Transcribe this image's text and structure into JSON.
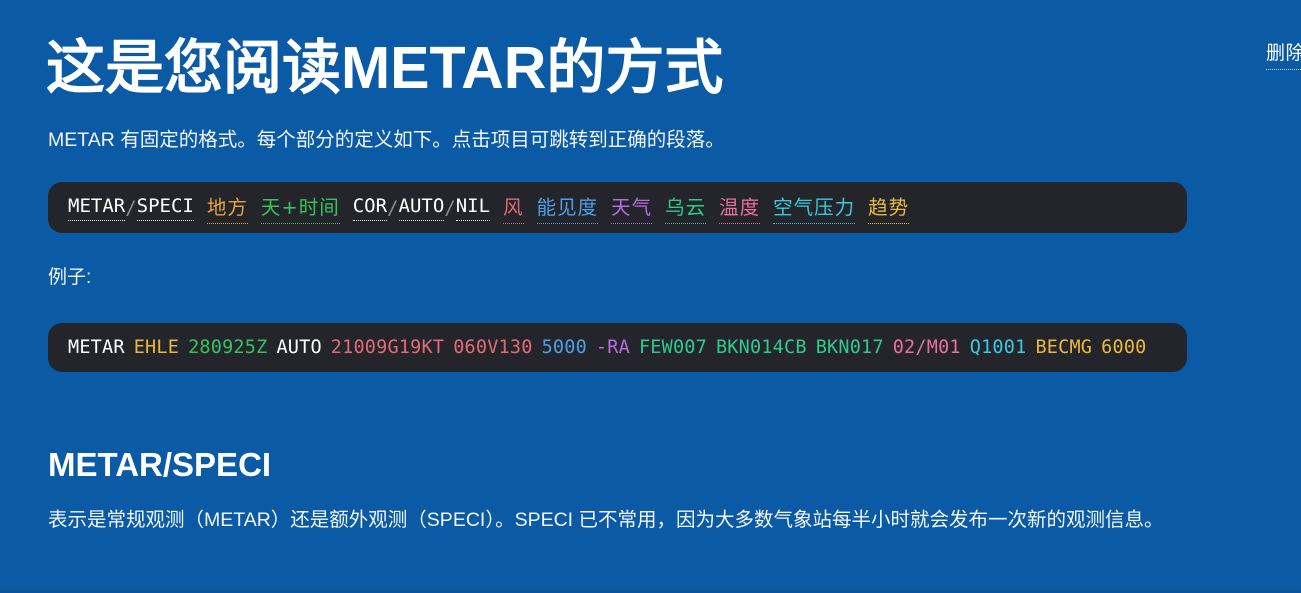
{
  "page": {
    "background_color": "#0b5aa5",
    "title": "这是您阅读METAR的方式",
    "intro": "METAR 有固定的格式。每个部分的定义如下。点击项目可跳转到正确的段落。",
    "example_label": "例子:",
    "corner_link": "删除"
  },
  "legend_bar": {
    "background_color": "#23252b",
    "tokens": [
      {
        "text": "METAR",
        "color": "#ffffff",
        "underline": "dotted"
      },
      {
        "text": "/",
        "color": "#8a8f98",
        "underline": "none"
      },
      {
        "text": "SPECI",
        "color": "#ffffff",
        "underline": "dotted"
      },
      {
        "text": "地方",
        "color": "#e8a33d",
        "underline": "dotted"
      },
      {
        "text": "天+时间",
        "color": "#35c45f",
        "underline": "dotted"
      },
      {
        "text": "COR",
        "color": "#ffffff",
        "underline": "dotted"
      },
      {
        "text": "/",
        "color": "#8a8f98",
        "underline": "none"
      },
      {
        "text": "AUTO",
        "color": "#ffffff",
        "underline": "dotted"
      },
      {
        "text": "/",
        "color": "#8a8f98",
        "underline": "none"
      },
      {
        "text": "NIL",
        "color": "#ffffff",
        "underline": "dotted"
      },
      {
        "text": "风",
        "color": "#e06c75",
        "underline": "dotted"
      },
      {
        "text": "能见度",
        "color": "#4d9fe8",
        "underline": "dotted"
      },
      {
        "text": "天气",
        "color": "#b76de0",
        "underline": "dotted"
      },
      {
        "text": "乌云",
        "color": "#33c98d",
        "underline": "dotted"
      },
      {
        "text": "温度",
        "color": "#e8709b",
        "underline": "dotted"
      },
      {
        "text": "空气压力",
        "color": "#3ec8e0",
        "underline": "dotted"
      },
      {
        "text": "趋势",
        "color": "#e8b93d",
        "underline": "dotted"
      }
    ]
  },
  "example_bar": {
    "background_color": "#23252b",
    "tokens": [
      {
        "text": "METAR",
        "color": "#ffffff"
      },
      {
        "text": "EHLE",
        "color": "#e8b93d"
      },
      {
        "text": "280925Z",
        "color": "#35c45f"
      },
      {
        "text": "AUTO",
        "color": "#ffffff"
      },
      {
        "text": "21009G19KT",
        "color": "#e06c75"
      },
      {
        "text": "060V130",
        "color": "#e06c75"
      },
      {
        "text": "5000",
        "color": "#4d9fe8"
      },
      {
        "text": "-RA",
        "color": "#b76de0"
      },
      {
        "text": "FEW007",
        "color": "#33c98d"
      },
      {
        "text": "BKN014CB",
        "color": "#33c98d"
      },
      {
        "text": "BKN017",
        "color": "#33c98d"
      },
      {
        "text": "02/M01",
        "color": "#e8709b"
      },
      {
        "text": "Q1001",
        "color": "#3ec8e0"
      },
      {
        "text": "BECMG",
        "color": "#e8b93d"
      },
      {
        "text": "6000",
        "color": "#e8b93d"
      }
    ]
  },
  "section": {
    "heading": "METAR/SPECI",
    "body": "表示是常规观测（METAR）还是额外观测（SPECI）。SPECI 已不常用，因为大多数气象站每半小时就会发布一次新的观测信息。"
  }
}
